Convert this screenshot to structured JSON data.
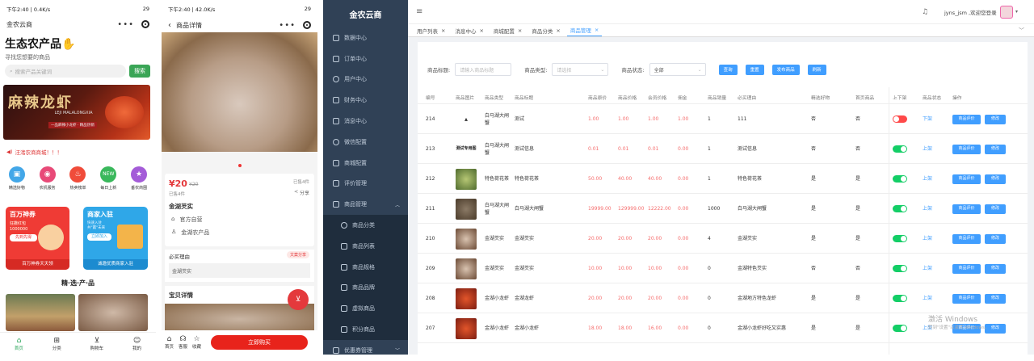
{
  "phone1": {
    "status": "下午2:40 | 0.4K/s",
    "status_right": "29",
    "app_title": "金农云商",
    "heading": "生态农产品",
    "subheading": "寻找您想要的商品",
    "search_placeholder": "搜索产品关键词",
    "search_btn": "搜索",
    "banner": {
      "title": "麻辣龙虾",
      "sub": "LEJI MALALONGXIA",
      "note": "一品麻辣小龙虾 · 精品热销"
    },
    "notice": "汪渚农商商城！！！",
    "categories": [
      "精选好物",
      "农机服务",
      "热卖榜单",
      "每日上新",
      "垂农商圈"
    ],
    "promo_left": {
      "title": "百万神券",
      "sub1": "狂撒红包",
      "amount": "1000000",
      "cta": "先到先得",
      "footer": "百万神券天天领"
    },
    "promo_right": {
      "title": "商家入驻",
      "sub": "快速入驻 共\"赢\"未来",
      "cta": "立即加入",
      "footer": "诚邀优质商家入驻"
    },
    "section_title": "精·选·产·品",
    "nav": [
      "首页",
      "分类",
      "购物车",
      "我的"
    ]
  },
  "phone2": {
    "status": "下午2:40 | 42.0K/s",
    "status_right": "29",
    "title": "商品详情",
    "price": "¥20",
    "old_price": "¥20",
    "sold": "已售4件",
    "sold_right": "已售4件",
    "share": "分享",
    "name": "金湖芡实",
    "shop": "官方自营",
    "origin": "金湖农产品",
    "reason_label": "必买理由",
    "reason_btn": "文案分享",
    "reason_text": "金湖芡实",
    "detail_title": "宝贝详情",
    "nav": [
      "首页",
      "客服",
      "收藏"
    ],
    "buy": "立即购买"
  },
  "admin": {
    "brand": "金农云商",
    "menu": [
      "数据中心",
      "订单中心",
      "用户中心",
      "财务中心",
      "消息中心",
      "微信配置",
      "商城配置",
      "评价管理",
      "商品管理"
    ],
    "submenu": [
      "商品分类",
      "商品列表",
      "商品规格",
      "商品品牌",
      "虚拟商品",
      "积分商品"
    ],
    "last_menu": "优惠券管理",
    "user": "jyns_jsm ,欢迎您登录",
    "tabs": [
      "用户列表",
      "消息中心",
      "商城配置",
      "商品分类",
      "商品管理"
    ],
    "filters": {
      "title_label": "商品标题:",
      "title_ph": "请输入商品标题",
      "type_label": "商品类型:",
      "type_ph": "请选择",
      "status_label": "商品状态:",
      "status_val": "全部"
    },
    "buttons": [
      "查询",
      "重置",
      "发布商品",
      "刷新"
    ],
    "columns": [
      "编号",
      "商品图片",
      "商品类型",
      "商品标题",
      "商品原价",
      "商品价格",
      "会员价格",
      "佣金",
      "商品销量",
      "必买理由",
      "精选好物",
      "首页商品",
      "上下架",
      "商品状态",
      "操作"
    ],
    "row_buttons": [
      "商品评价",
      "修改"
    ],
    "rows": [
      {
        "id": "214",
        "img": "logo",
        "type": "白马湖大闸蟹",
        "title": "测试",
        "orig": "1.00",
        "price": "1.00",
        "member": "1.00",
        "comm": "1.00",
        "sales": "1",
        "reason": "111",
        "featured": "否",
        "home": "否",
        "on": false,
        "status": "下架"
      },
      {
        "id": "213",
        "img": "text",
        "imgtext": "测试专用图",
        "type": "白马湖大闸蟹",
        "title": "测试信息",
        "orig": "0.01",
        "price": "0.01",
        "member": "0.01",
        "comm": "0.00",
        "sales": "1",
        "reason": "测试信息",
        "featured": "否",
        "home": "否",
        "on": true,
        "status": "上架"
      },
      {
        "id": "212",
        "img": "green",
        "type": "特色荷花茶",
        "title": "特色荷花茶",
        "orig": "50.00",
        "price": "40.00",
        "member": "40.00",
        "comm": "0.00",
        "sales": "1",
        "reason": "特色荷花茶",
        "featured": "是",
        "home": "是",
        "on": true,
        "status": "上架"
      },
      {
        "id": "211",
        "img": "crab",
        "type": "白马湖大闸蟹",
        "title": "白马湖大闸蟹",
        "orig": "19999.00",
        "price": "129999.00",
        "member": "12222.00",
        "comm": "0.00",
        "sales": "1000",
        "reason": "白马湖大闸蟹",
        "featured": "是",
        "home": "是",
        "on": true,
        "status": "上架"
      },
      {
        "id": "210",
        "img": "seed",
        "type": "金湖芡实",
        "title": "金湖芡实",
        "orig": "20.00",
        "price": "20.00",
        "member": "20.00",
        "comm": "0.00",
        "sales": "4",
        "reason": "金湖芡实",
        "featured": "是",
        "home": "是",
        "on": true,
        "status": "上架"
      },
      {
        "id": "209",
        "img": "seed",
        "type": "金湖芡实",
        "title": "金湖芡实",
        "orig": "10.00",
        "price": "10.00",
        "member": "10.00",
        "comm": "0.00",
        "sales": "0",
        "reason": "金湖特色芡实",
        "featured": "否",
        "home": "否",
        "on": true,
        "status": "上架"
      },
      {
        "id": "208",
        "img": "lobster",
        "type": "金湖小龙虾",
        "title": "金湖龙虾",
        "orig": "20.00",
        "price": "20.00",
        "member": "20.00",
        "comm": "0.00",
        "sales": "0",
        "reason": "金湖地方特色龙虾",
        "featured": "是",
        "home": "是",
        "on": true,
        "status": "上架"
      },
      {
        "id": "207",
        "img": "lobster",
        "type": "金湖小龙虾",
        "title": "金湖小龙虾",
        "orig": "18.00",
        "price": "18.00",
        "member": "16.00",
        "comm": "0.00",
        "sales": "0",
        "reason": "金湖小龙虾好吃又实惠",
        "featured": "是",
        "home": "是",
        "on": true,
        "status": "上架"
      }
    ],
    "watermark": "激活 Windows",
    "watermark_sub": "转到\"设置\"以激活 Windows。"
  }
}
